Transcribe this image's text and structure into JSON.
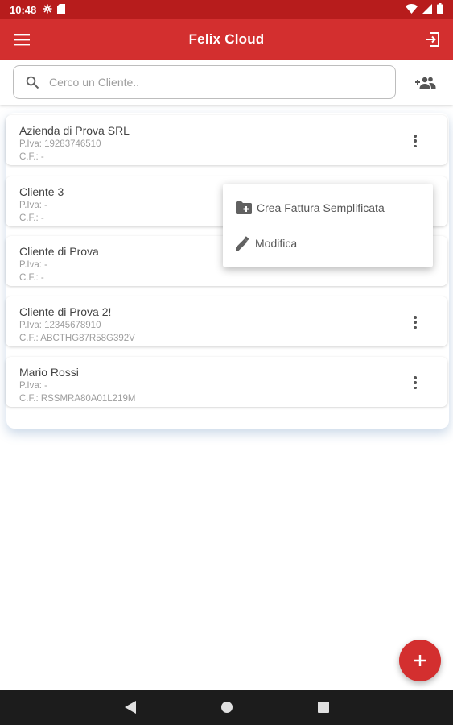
{
  "status_bar": {
    "time": "10:48"
  },
  "app_bar": {
    "title": "Felix Cloud"
  },
  "search": {
    "placeholder": "Cerco un Cliente..",
    "value": ""
  },
  "clients": [
    {
      "name": "Azienda di Prova SRL",
      "piva": "P.Iva: 19283746510",
      "cf": "C.F.: -"
    },
    {
      "name": "Cliente 3",
      "piva": "P.Iva: -",
      "cf": "C.F.: -"
    },
    {
      "name": "Cliente di Prova",
      "piva": "P.Iva: -",
      "cf": "C.F.: -"
    },
    {
      "name": "Cliente di Prova 2!",
      "piva": "P.Iva: 12345678910",
      "cf": "C.F.: ABCTHG87R58G392V"
    },
    {
      "name": "Mario Rossi",
      "piva": "P.Iva: -",
      "cf": "C.F.: RSSMRA80A01L219M"
    }
  ],
  "context_menu": {
    "items": [
      {
        "label": "Crea Fattura Semplificata",
        "icon": "folder-add-icon"
      },
      {
        "label": "Modifica",
        "icon": "pencil-icon"
      }
    ]
  },
  "fab": {
    "icon": "plus-icon"
  },
  "colors": {
    "primary": "#d32f2f",
    "status_bar": "#b71c1c",
    "nav_bar": "#1c1c1c"
  }
}
